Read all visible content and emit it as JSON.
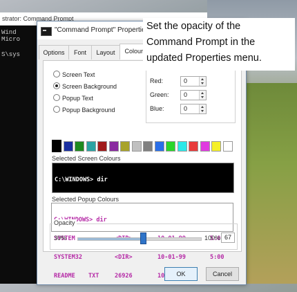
{
  "background_console": {
    "title": "strator: Command Prompt",
    "lines": [
      "Wind",
      "Micro",
      "S\\sys"
    ]
  },
  "dialog": {
    "title": "\"Command Prompt\" Properties",
    "tabs": [
      {
        "label": "Options"
      },
      {
        "label": "Font"
      },
      {
        "label": "Layout"
      },
      {
        "label": "Colours"
      }
    ],
    "radios": [
      {
        "label": "Screen Text",
        "selected": false
      },
      {
        "label": "Screen Background",
        "selected": true
      },
      {
        "label": "Popup Text",
        "selected": false
      },
      {
        "label": "Popup Background",
        "selected": false
      }
    ],
    "rgb": {
      "red_label": "Red:",
      "red_value": "0",
      "green_label": "Green:",
      "green_value": "0",
      "blue_label": "Blue:",
      "blue_value": "0"
    },
    "swatch_colors": [
      "#000000",
      "#1a2fa0",
      "#1e8a1e",
      "#2aa3a3",
      "#a01a1a",
      "#8a2aa0",
      "#a8a32a",
      "#c0c0c0",
      "#808080",
      "#2a6fe8",
      "#2ad62a",
      "#2ae8e8",
      "#e83a3a",
      "#e03ae0",
      "#f5f02a",
      "#ffffff"
    ],
    "selected_screen_label": "Selected Screen Colours",
    "selected_popup_label": "Selected Popup Colours",
    "preview": {
      "prompt": "C:\\WINDOWS> dir",
      "rows": [
        {
          "name": "SYSTEM",
          "ext": "",
          "size": "<DIR>",
          "date": "10-01-99",
          "time": "5:00"
        },
        {
          "name": "SYSTEM32",
          "ext": "",
          "size": "<DIR>",
          "date": "10-01-99",
          "time": "5:00"
        },
        {
          "name": "README",
          "ext": "TXT",
          "size": "26926",
          "date": "10-01-99",
          "time": "5:00"
        }
      ]
    },
    "opacity": {
      "label": "Opacity",
      "min_label": "30%",
      "max_label": "100%",
      "value": "67",
      "fraction": 0.53
    },
    "ok_label": "OK",
    "cancel_label": "Cancel"
  },
  "caption": {
    "line1": "Set the opacity of the",
    "line2": "Command Prompt in the",
    "line3": "updated Properties menu."
  },
  "colors": {
    "popup_text": "#b52aa6",
    "accent": "#2f74c8"
  }
}
